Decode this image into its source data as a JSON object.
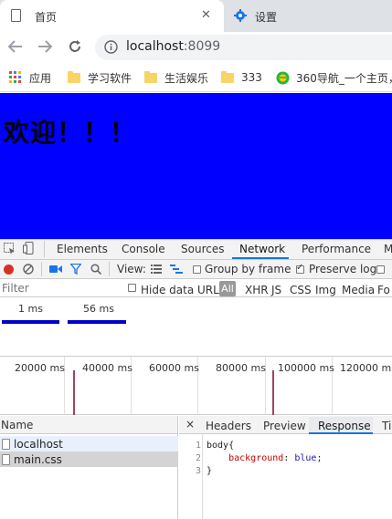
{
  "browser": {
    "tabs": [
      {
        "title": "首页",
        "active": true
      },
      {
        "title": "设置",
        "active": false
      }
    ],
    "close_glyph": "✕",
    "url_host": "localhost",
    "url_port": ":8099",
    "bookmarks": [
      {
        "label": "应用",
        "icon": "apps-grid-icon"
      },
      {
        "label": "学习软件",
        "icon": "folder-icon"
      },
      {
        "label": "生活娱乐",
        "icon": "folder-icon"
      },
      {
        "label": "333",
        "icon": "folder-icon"
      },
      {
        "label": "360导航_一个主页，",
        "icon": "360-logo-icon"
      }
    ]
  },
  "page": {
    "heading": "欢迎！！！",
    "background": "#0000ff"
  },
  "devtools": {
    "tabs": [
      "Elements",
      "Console",
      "Sources",
      "Network",
      "Performance",
      "M"
    ],
    "active_tab": "Network",
    "toolbar": {
      "view_label": "View:",
      "group_by_frame": "Group by frame",
      "preserve_log": "Preserve log",
      "preserve_log_checked": true,
      "group_by_frame_checked": false
    },
    "filter": {
      "placeholder": "Filter",
      "hide_data_urls": "Hide data URLs",
      "types": [
        "All",
        "XHR",
        "JS",
        "CSS",
        "Img",
        "Media",
        "Fo"
      ]
    },
    "overview": {
      "labels": [
        "1 ms",
        "56 ms"
      ]
    },
    "timeline": {
      "ticks": [
        "20000 ms",
        "40000 ms",
        "60000 ms",
        "80000 ms",
        "100000 ms",
        "120000 ms"
      ]
    },
    "requests": {
      "header": "Name",
      "close_glyph": "×",
      "rows": [
        "localhost",
        "main.css"
      ]
    },
    "detail": {
      "tabs": [
        "Headers",
        "Preview",
        "Response",
        "Ti"
      ],
      "active_tab": "Response",
      "lines": [
        {
          "num": "1",
          "text": "body{"
        },
        {
          "num": "2",
          "prop": "background",
          "sep": ": ",
          "value": "blue",
          "end": ";"
        },
        {
          "num": "3",
          "text": "}"
        }
      ]
    }
  },
  "colors": {
    "accent": "#1a73e8",
    "record": "#d93025",
    "timeline_marker": "#a0445a",
    "overview_bar": "#0000cc"
  }
}
